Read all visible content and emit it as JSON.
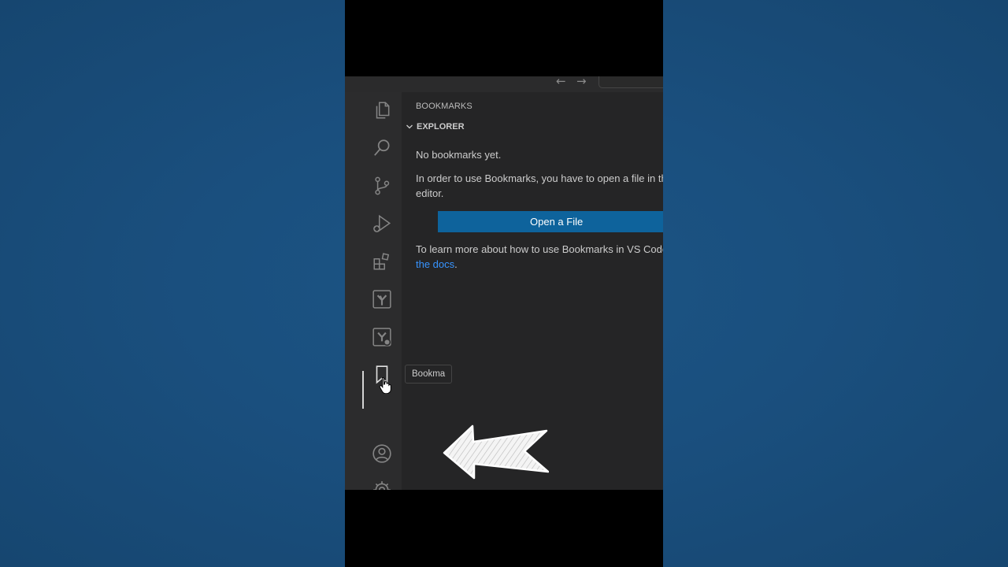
{
  "sidebar": {
    "title": "BOOKMARKS",
    "section": "EXPLORER",
    "empty_message": "No bookmarks yet.",
    "instructions_line1": "In order to use Bookmarks, you have to open a file in th",
    "instructions_line2": "editor.",
    "open_button_label": "Open a File",
    "learn_line1": "To learn more about how to use Bookmarks in VS Code",
    "learn_link": "the docs",
    "learn_suffix": "."
  },
  "tooltip": {
    "text": "Bookma"
  },
  "activity_bar": {
    "items": [
      {
        "name": "explorer",
        "icon": "files-icon"
      },
      {
        "name": "search",
        "icon": "search-icon"
      },
      {
        "name": "source-control",
        "icon": "source-control-icon"
      },
      {
        "name": "run-debug",
        "icon": "run-debug-icon"
      },
      {
        "name": "extensions",
        "icon": "extensions-icon"
      },
      {
        "name": "azure",
        "icon": "azure-tree-icon"
      },
      {
        "name": "azure-remote",
        "icon": "azure-tree-badge-icon"
      },
      {
        "name": "bookmarks",
        "icon": "bookmark-icon",
        "active": true
      },
      {
        "name": "accounts",
        "icon": "account-icon"
      },
      {
        "name": "manage",
        "icon": "gear-icon"
      }
    ]
  },
  "colors": {
    "button": "#0e639c",
    "link": "#3794ff",
    "editor_bg": "#252526",
    "activity_bg": "#2c2c2d",
    "page_bg": "#1a4f7e"
  }
}
